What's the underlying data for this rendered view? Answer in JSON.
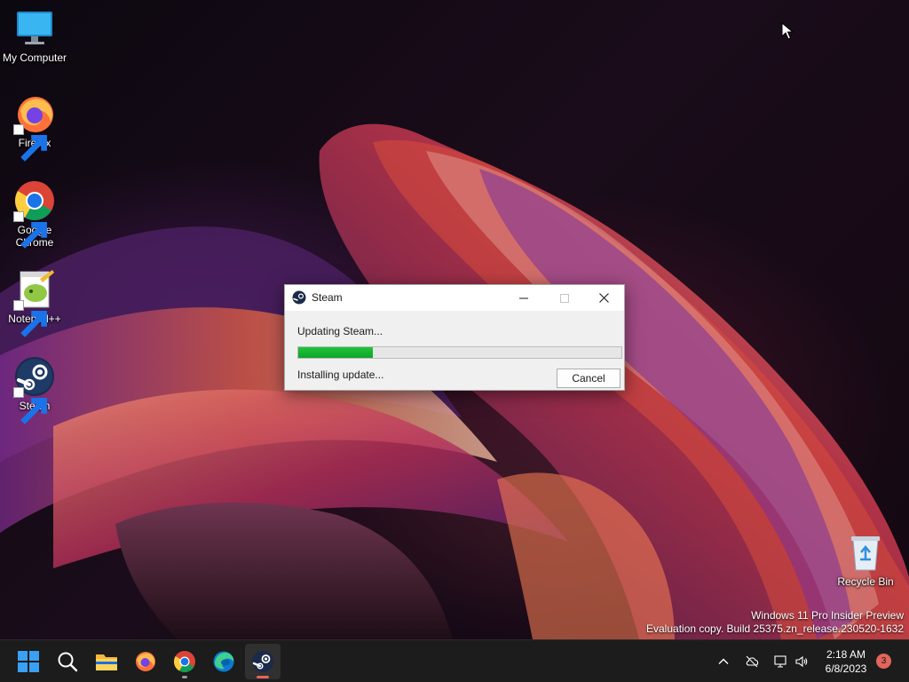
{
  "desktop": {
    "icons": [
      {
        "label": "My Computer",
        "icon": "monitor-icon"
      },
      {
        "label": "Firefox",
        "icon": "firefox-icon"
      },
      {
        "label": "Google Chrome",
        "icon": "chrome-icon"
      },
      {
        "label": "Notepad++",
        "icon": "notepad-plus-plus-icon"
      },
      {
        "label": "Steam",
        "icon": "steam-icon"
      },
      {
        "label": "Recycle Bin",
        "icon": "recycle-bin-icon"
      }
    ],
    "watermark": {
      "line1": "Windows 11 Pro Insider Preview",
      "line2": "Evaluation copy. Build 25375.zn_release.230520-1632"
    }
  },
  "dialog": {
    "title": "Steam",
    "status": "Updating Steam...",
    "progress_fraction": 0.23,
    "substatus": "Installing update...",
    "cancel_label": "Cancel",
    "colors": {
      "progress": "#16b232"
    }
  },
  "taskbar": {
    "apps": [
      {
        "name": "start",
        "icon": "windows-start-icon"
      },
      {
        "name": "search",
        "icon": "search-icon"
      },
      {
        "name": "file-explorer",
        "icon": "folder-icon"
      },
      {
        "name": "firefox",
        "icon": "firefox-icon"
      },
      {
        "name": "chrome",
        "icon": "chrome-icon"
      },
      {
        "name": "edge",
        "icon": "edge-icon"
      },
      {
        "name": "steam",
        "icon": "steam-icon",
        "active": true
      }
    ],
    "tray": {
      "time": "2:18 AM",
      "date": "6/8/2023",
      "notifications": "3"
    }
  }
}
